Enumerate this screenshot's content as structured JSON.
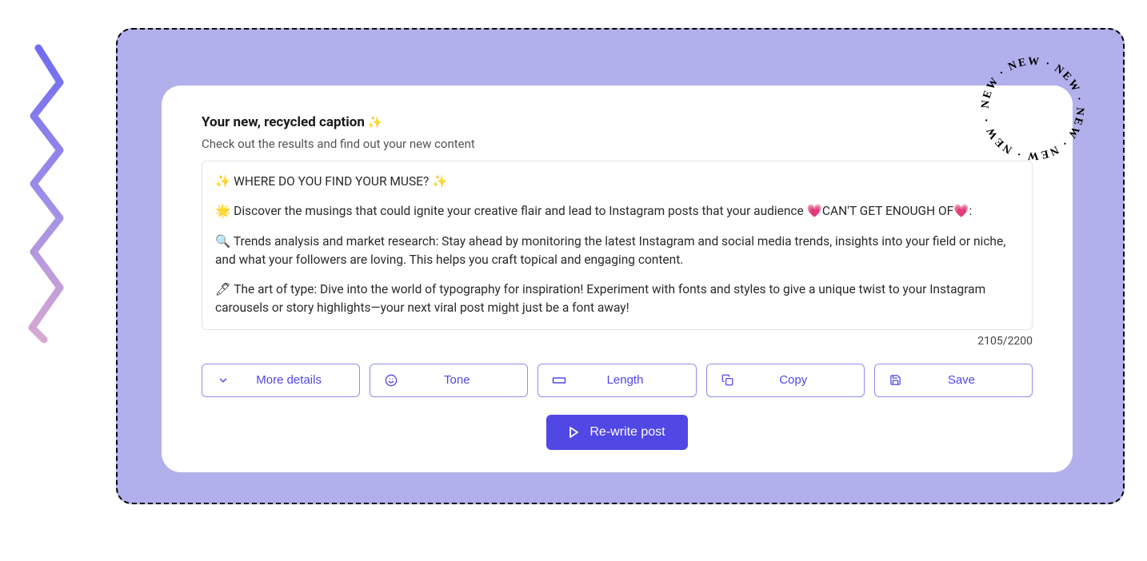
{
  "header": {
    "title": "Your new, recycled caption",
    "title_emoji": "✨",
    "subtitle": "Check out the results and find out your new content"
  },
  "caption": {
    "paragraphs": [
      "✨ WHERE DO YOU FIND YOUR MUSE? ✨",
      "🌟 Discover the musings that could ignite your creative flair and lead to Instagram posts that your audience 💗CAN'T GET ENOUGH OF💗:",
      "🔍 Trends analysis and market research: Stay ahead by monitoring the latest Instagram and social media trends, insights into your field or niche, and what your followers are loving. This helps you craft topical and engaging content.",
      "🖊 The art of type: Dive into the world of typography for inspiration! Experiment with fonts and styles to give a unique twist to your Instagram carousels or story highlights—your next viral post might just be a font away!"
    ],
    "char_count": "2105/2200"
  },
  "buttons": {
    "more_details": "More details",
    "tone": "Tone",
    "length": "Length",
    "copy": "Copy",
    "save": "Save",
    "rewrite": "Re-write post"
  },
  "badge": {
    "text": "NEW"
  }
}
